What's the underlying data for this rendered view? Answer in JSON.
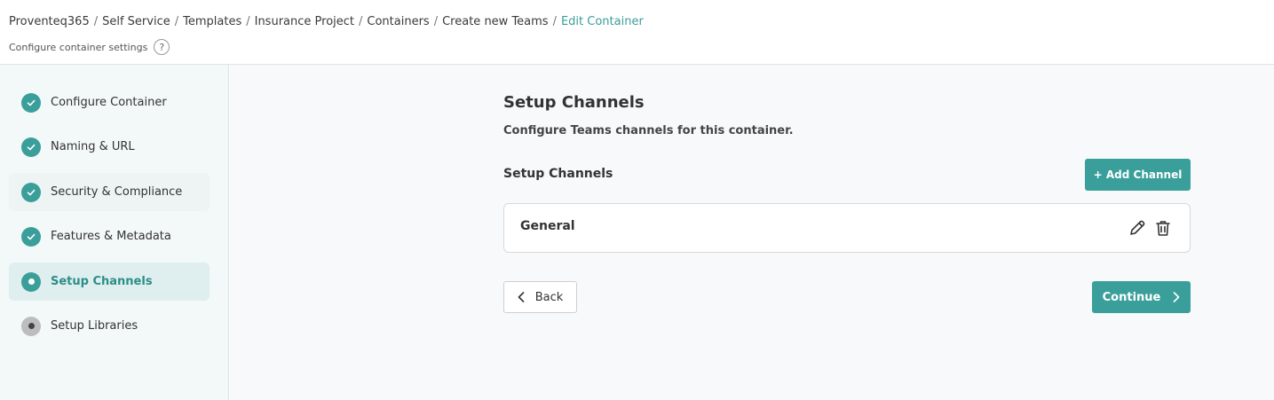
{
  "breadcrumb": {
    "items": [
      "Proventeq365",
      "Self Service",
      "Templates",
      "Insurance Project",
      "Containers",
      "Create new Teams"
    ],
    "current": "Edit Container",
    "separator": "/"
  },
  "header": {
    "subtitle": "Configure container settings",
    "help_symbol": "?"
  },
  "sidebar": {
    "steps": [
      {
        "label": "Configure Container",
        "status": "complete"
      },
      {
        "label": "Naming & URL",
        "status": "complete"
      },
      {
        "label": "Security & Compliance",
        "status": "complete"
      },
      {
        "label": "Features & Metadata",
        "status": "complete"
      },
      {
        "label": "Setup Channels",
        "status": "active"
      },
      {
        "label": "Setup Libraries",
        "status": "pending"
      }
    ]
  },
  "main": {
    "title": "Setup Channels",
    "description": "Configure Teams channels for this container.",
    "section_title": "Setup Channels",
    "add_button": "+ Add Channel",
    "channels": [
      {
        "name": "General"
      }
    ],
    "back_button": "Back",
    "continue_button": "Continue"
  },
  "colors": {
    "accent": "#3a9f9a",
    "pending": "#bdbdbd"
  },
  "icons": {
    "complete": "check-icon",
    "edit": "pencil-icon",
    "delete": "trash-icon",
    "back": "chevron-left-icon",
    "continue": "chevron-right-icon",
    "help": "question-icon"
  }
}
